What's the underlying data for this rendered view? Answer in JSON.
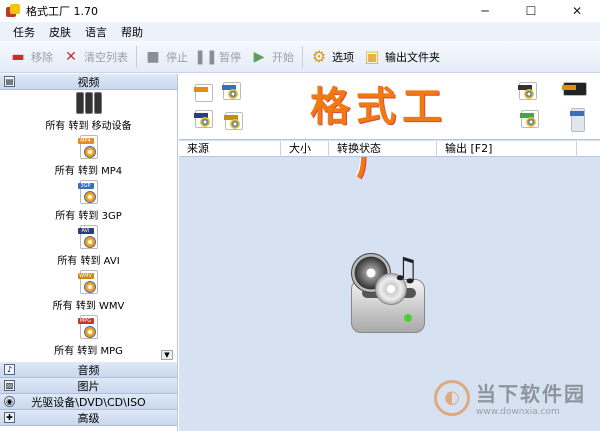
{
  "window": {
    "title": "格式工厂 1.70",
    "minimize": "─",
    "maximize": "☐",
    "close": "✕"
  },
  "menu": [
    "任务",
    "皮肤",
    "语言",
    "帮助"
  ],
  "toolbar": {
    "remove": "移除",
    "clear": "清空列表",
    "stop": "停止",
    "pause": "暂停",
    "start": "开始",
    "options": "选项",
    "output_folder": "输出文件夹"
  },
  "left": {
    "video_header": "视频",
    "video_items": [
      {
        "label": "所有 转到 移动设备",
        "tag": ""
      },
      {
        "label": "所有 转到 MP4",
        "tag": "MP4"
      },
      {
        "label": "所有 转到 3GP",
        "tag": "3GP"
      },
      {
        "label": "所有 转到 AVI",
        "tag": "AVI"
      },
      {
        "label": "所有 转到 WMV",
        "tag": "WMV"
      },
      {
        "label": "所有 转到 MPG",
        "tag": "MPG"
      }
    ],
    "audio_header": "音频",
    "image_header": "图片",
    "rom_header": "光驱设备\\DVD\\CD\\ISO",
    "advanced_header": "高级"
  },
  "banner": {
    "title": "格式工厂",
    "left_icons": [
      "MP4",
      "3GP",
      "AVI",
      "WMV"
    ],
    "right_icons": [
      "DVD",
      "MP4",
      "MP3"
    ]
  },
  "table": {
    "headers": [
      "来源",
      "大小",
      "转换状态",
      "输出 [F2]"
    ]
  },
  "watermark": {
    "name": "当下软件园",
    "url": "www.downxia.com"
  }
}
